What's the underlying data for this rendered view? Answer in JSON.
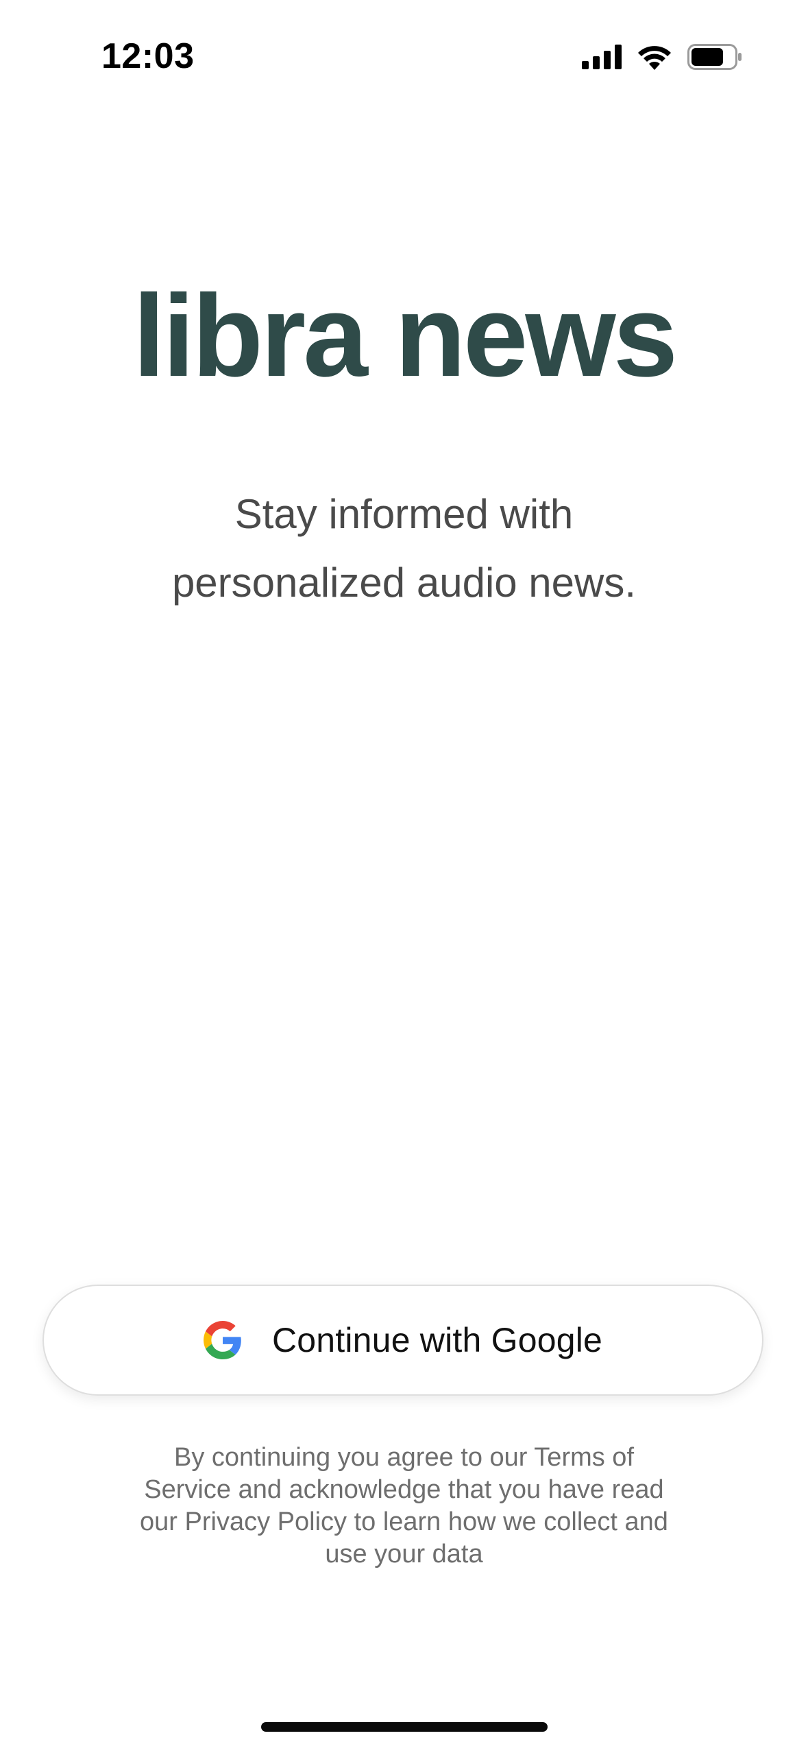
{
  "status_bar": {
    "time": "12:03",
    "icons": [
      "cellular-signal-icon",
      "wifi-icon",
      "battery-icon"
    ]
  },
  "brand": {
    "title": "libra news",
    "color": "#2f4b49"
  },
  "tagline": {
    "line1": "Stay informed with",
    "line2": "personalized audio news."
  },
  "auth": {
    "google_button_label": "Continue with Google",
    "google_icon": "google-g-icon"
  },
  "legal": {
    "text": "By continuing you agree to our Terms of Service and acknowledge that you have read our Privacy Policy to learn how we collect and use your data"
  }
}
